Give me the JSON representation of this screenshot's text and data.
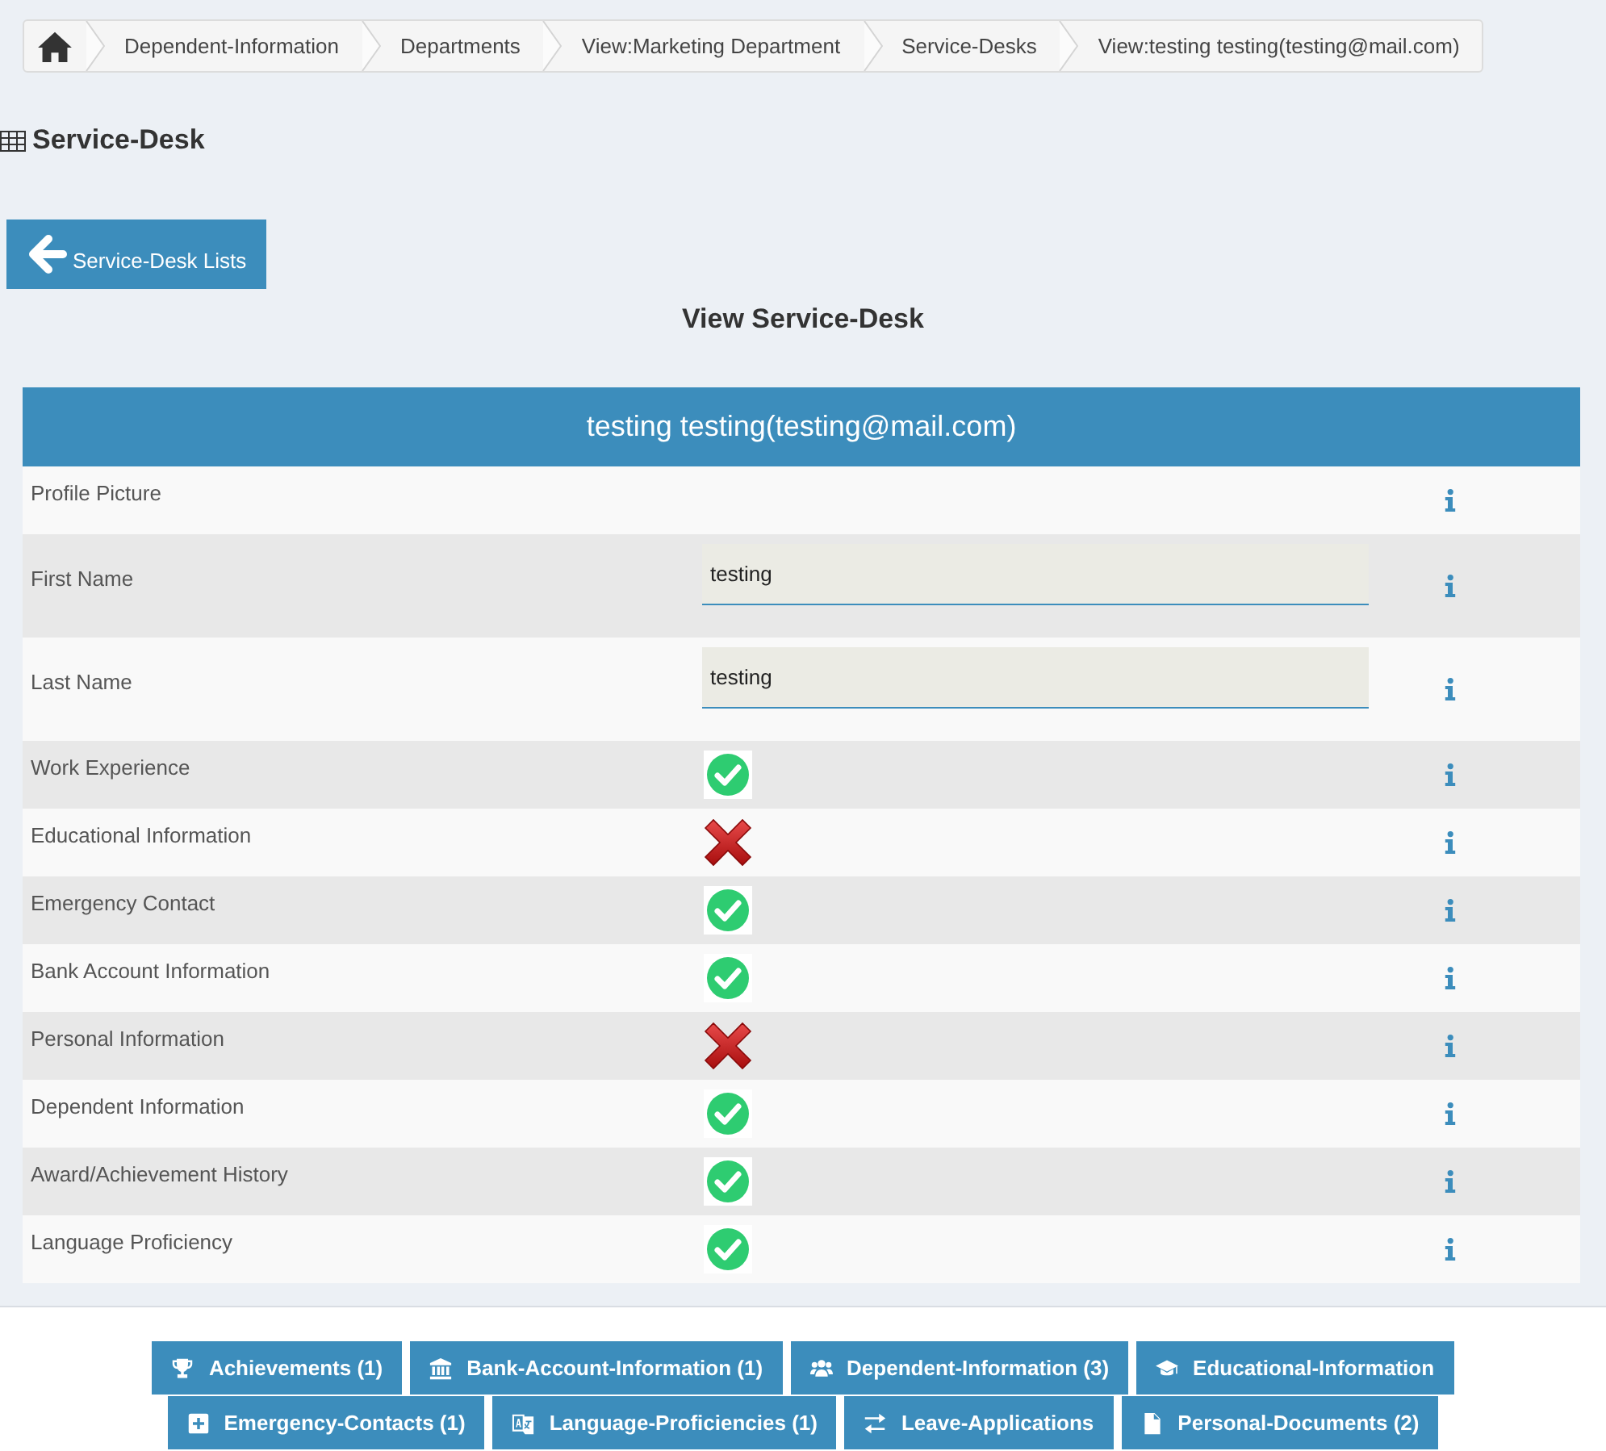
{
  "breadcrumb": {
    "items": [
      "Dependent-Information",
      "Departments",
      "View:Marketing Department",
      "Service-Desks",
      "View:testing testing(testing@mail.com)"
    ]
  },
  "page_title": "Service-Desk",
  "back_button": "Service-Desk Lists",
  "section_title": "View Service-Desk",
  "record": {
    "title": "testing testing(testing@mail.com)",
    "fields": [
      {
        "label": "Profile Picture",
        "kind": "picture"
      },
      {
        "label": "First Name",
        "kind": "text",
        "value": "testing"
      },
      {
        "label": "Last Name",
        "kind": "text",
        "value": "testing"
      },
      {
        "label": "Work Experience",
        "kind": "status",
        "checked": true
      },
      {
        "label": "Educational Information",
        "kind": "status",
        "checked": false
      },
      {
        "label": "Emergency Contact",
        "kind": "status",
        "checked": true
      },
      {
        "label": "Bank Account Information",
        "kind": "status",
        "checked": true
      },
      {
        "label": "Personal Information",
        "kind": "status",
        "checked": false
      },
      {
        "label": "Dependent Information",
        "kind": "status",
        "checked": true
      },
      {
        "label": "Award/Achievement History",
        "kind": "status",
        "checked": true
      },
      {
        "label": "Language Proficiency",
        "kind": "status",
        "checked": true
      }
    ]
  },
  "related_buttons": [
    "Achievements (1)",
    "Bank-Account-Information (1)",
    "Dependent-Information (3)",
    "Educational-Information",
    "Emergency-Contacts (1)",
    "Language-Proficiencies (1)",
    "Leave-Applications",
    "Personal-Documents (2)"
  ]
}
